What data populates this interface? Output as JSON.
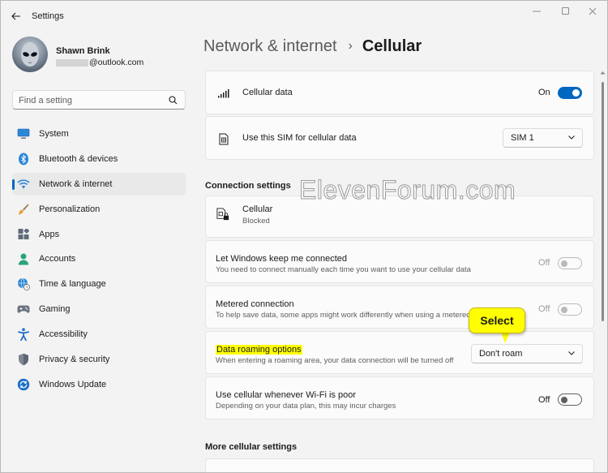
{
  "app": {
    "title": "Settings"
  },
  "window_controls": {
    "minimize": "minimize",
    "maximize": "maximize",
    "close": "close"
  },
  "profile": {
    "name": "Shawn Brink",
    "email_domain": "@outlook.com"
  },
  "search": {
    "placeholder": "Find a setting"
  },
  "nav": [
    {
      "label": "System",
      "icon": "display-icon",
      "active": false
    },
    {
      "label": "Bluetooth & devices",
      "icon": "bluetooth-icon",
      "active": false
    },
    {
      "label": "Network & internet",
      "icon": "wifi-icon",
      "active": true
    },
    {
      "label": "Personalization",
      "icon": "brush-icon",
      "active": false
    },
    {
      "label": "Apps",
      "icon": "apps-icon",
      "active": false
    },
    {
      "label": "Accounts",
      "icon": "person-icon",
      "active": false
    },
    {
      "label": "Time & language",
      "icon": "globe-clock-icon",
      "active": false
    },
    {
      "label": "Gaming",
      "icon": "gamepad-icon",
      "active": false
    },
    {
      "label": "Accessibility",
      "icon": "accessibility-icon",
      "active": false
    },
    {
      "label": "Privacy & security",
      "icon": "shield-icon",
      "active": false
    },
    {
      "label": "Windows Update",
      "icon": "update-icon",
      "active": false
    }
  ],
  "breadcrumb": {
    "parent": "Network & internet",
    "separator": "›",
    "current": "Cellular"
  },
  "cellular_data": {
    "label": "Cellular data",
    "state_label": "On",
    "on": true
  },
  "sim": {
    "label": "Use this SIM for cellular data",
    "selected": "SIM 1"
  },
  "connection_settings": {
    "header": "Connection settings",
    "cellular": {
      "title": "Cellular",
      "status": "Blocked"
    },
    "keep_connected": {
      "title": "Let Windows keep me connected",
      "description": "You need to connect manually each time you want to use your cellular data",
      "state_label": "Off",
      "on": false,
      "disabled": true
    },
    "metered": {
      "title": "Metered connection",
      "description": "To help save data, some apps might work differently when using a metered",
      "state_label": "Off",
      "on": false,
      "disabled": true
    },
    "roaming": {
      "title": "Data roaming options",
      "description": "When entering a roaming area, your data connection will be turned off",
      "selected": "Don't roam"
    },
    "wifi_poor": {
      "title": "Use cellular whenever Wi-Fi is poor",
      "description": "Depending on your data plan, this may incur charges",
      "state_label": "Off",
      "on": false,
      "disabled": false
    }
  },
  "more_settings": {
    "header": "More cellular settings"
  },
  "watermark": "ElevenForum.com",
  "callout": {
    "text": "Select",
    "color": "#ffff00"
  },
  "colors": {
    "accent": "#0067c0",
    "highlight": "#ffff00"
  }
}
